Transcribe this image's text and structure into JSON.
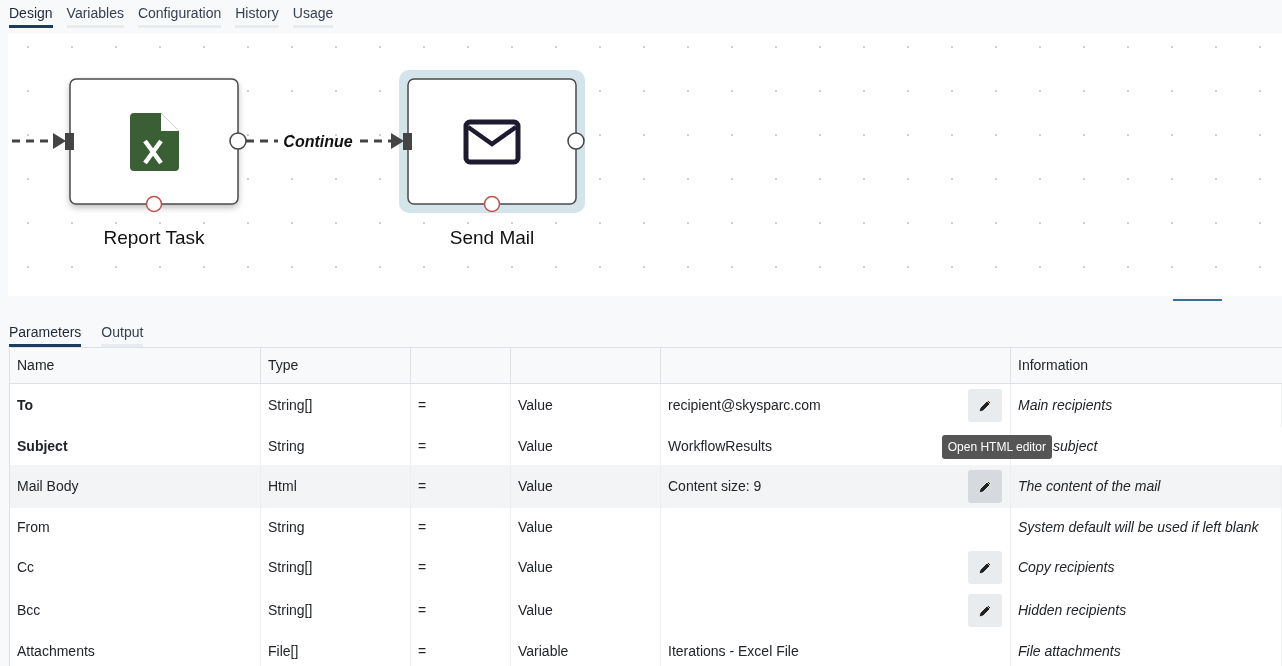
{
  "tabs": [
    {
      "label": "Design",
      "selected": true
    },
    {
      "label": "Variables",
      "selected": false
    },
    {
      "label": "Configuration",
      "selected": false
    },
    {
      "label": "History",
      "selected": false
    },
    {
      "label": "Usage",
      "selected": false
    }
  ],
  "diagram": {
    "nodes": [
      {
        "kind": "excel",
        "label": "Report Task",
        "selected": false
      },
      {
        "kind": "mail",
        "label": "Send Mail",
        "selected": true
      }
    ],
    "connections": [
      {
        "label": "Continue"
      }
    ]
  },
  "panel_tabs": [
    {
      "label": "Parameters",
      "selected": true
    },
    {
      "label": "Output",
      "selected": false
    }
  ],
  "table": {
    "columns": {
      "name": "Name",
      "type": "Type",
      "information": "Information"
    },
    "rows": [
      {
        "name": "To",
        "required": true,
        "type": "String[]",
        "operator": "=",
        "source": "Value",
        "value": "recipient@skysparc.com",
        "editable": true,
        "information": "Main recipients",
        "highlighted": false
      },
      {
        "name": "Subject",
        "required": true,
        "type": "String",
        "operator": "=",
        "source": "Value",
        "value": "WorkflowResults",
        "editable": false,
        "information": "subject",
        "information_partly_hidden": true,
        "highlighted": false
      },
      {
        "name": "Mail Body",
        "required": false,
        "type": "Html",
        "operator": "=",
        "source": "Value",
        "value": "Content size: 9",
        "editable": true,
        "tooltip": "Open HTML editor",
        "information": "The content of the mail",
        "highlighted": true
      },
      {
        "name": "From",
        "required": false,
        "type": "String",
        "operator": "=",
        "source": "Value",
        "editable": false,
        "information": "System default will be used if left blank",
        "highlighted": false
      },
      {
        "name": "Cc",
        "required": false,
        "type": "String[]",
        "operator": "=",
        "source": "Value",
        "editable": true,
        "information": "Copy recipients",
        "highlighted": false
      },
      {
        "name": "Bcc",
        "required": false,
        "type": "String[]",
        "operator": "=",
        "source": "Value",
        "editable": true,
        "information": "Hidden recipients",
        "highlighted": false
      },
      {
        "name": "Attachments",
        "required": false,
        "type": "File[]",
        "operator": "=",
        "source": "Variable",
        "value": "Iterations - Excel File",
        "editable": false,
        "information": "File attachments",
        "highlighted": false
      }
    ]
  }
}
